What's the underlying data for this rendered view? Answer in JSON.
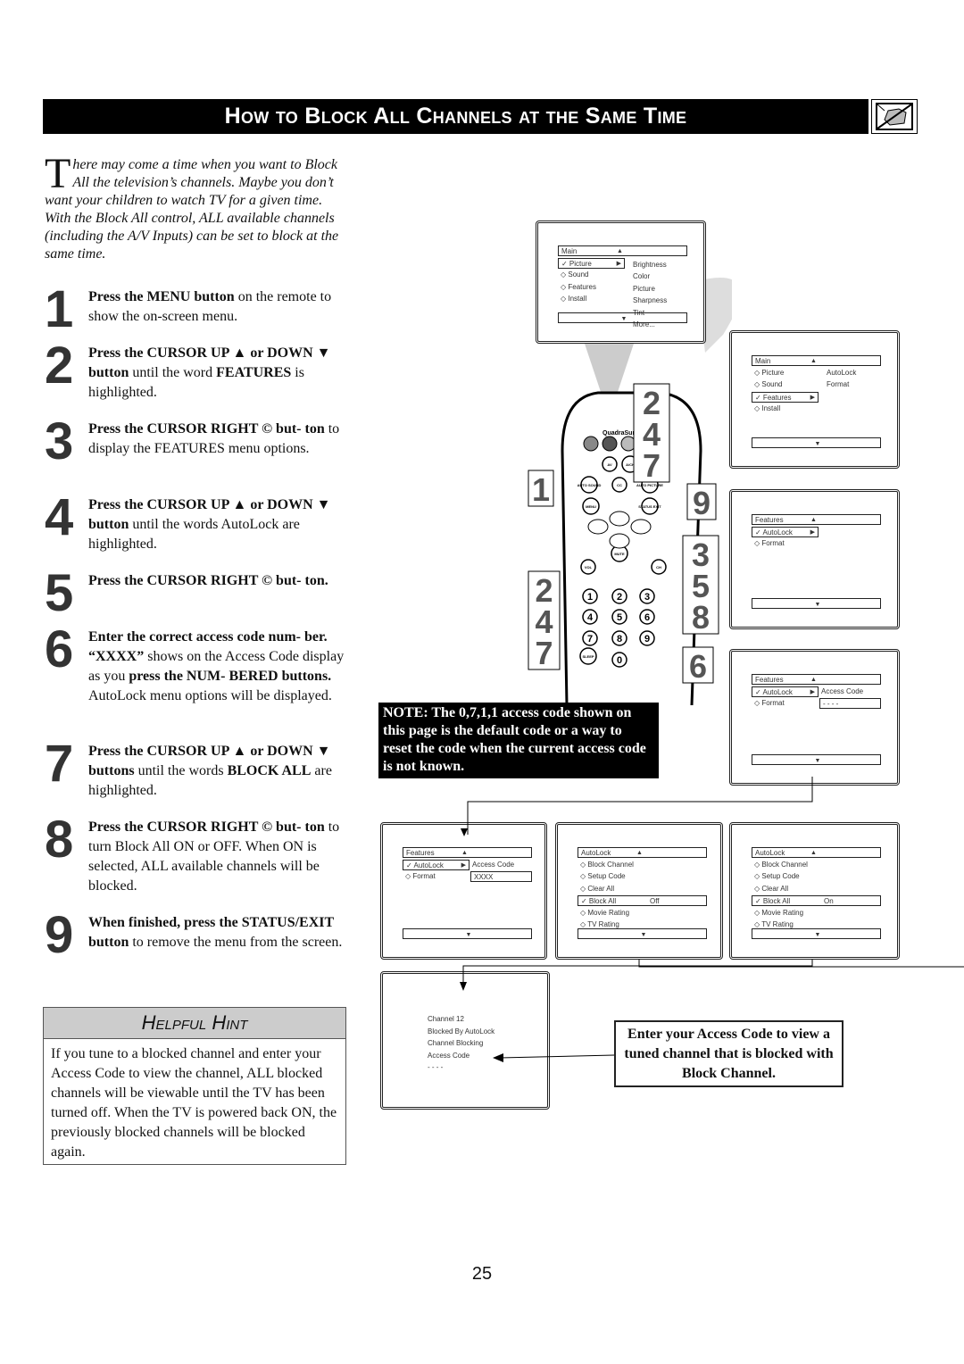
{
  "header": {
    "title": "How to Block All Channels at the Same Time",
    "icon": "no-hand-icon"
  },
  "intro": {
    "dropcap": "T",
    "text": "here may come a time when you want to Block All the television’s channels. Maybe you don’t want your children to watch TV for a given time. With the Block All control, ALL available channels (including the A/V Inputs) can be set to block at the same time."
  },
  "steps": [
    {
      "num": "1",
      "html": "<b>Press the MENU button</b> on the remote to show the on-screen menu."
    },
    {
      "num": "2",
      "html": "<b>Press the CURSOR UP ▲ or DOWN ▼ button</b> until the word <b>FEATURES</b> is highlighted."
    },
    {
      "num": "3",
      "html": "<b>Press the CURSOR RIGHT © but-</b> <b>ton</b> to display the FEATURES menu options."
    },
    {
      "num": "4",
      "html": "<b>Press the CURSOR UP ▲ or DOWN ▼ button</b> until the words AutoLock are highlighted."
    },
    {
      "num": "5",
      "html": "<b>Press the CURSOR RIGHT © but- ton.</b>"
    },
    {
      "num": "6",
      "html": "<b>Enter the correct access code num- ber. “XXXX”</b> shows on the Access Code display as you <b>press the NUM- BERED buttons.</b> AutoLock menu options will be displayed."
    },
    {
      "num": "7",
      "html": "<b>Press the CURSOR UP ▲ or DOWN ▼ buttons</b> until the words <b>BLOCK ALL</b> are highlighted."
    },
    {
      "num": "8",
      "html": "<b>Press the CURSOR RIGHT © but-</b> <b>ton</b> to turn Block All ON or OFF. When ON is selected, ALL available channels will be blocked."
    },
    {
      "num": "9",
      "html": "<b>When finished, press the STATUS/EXIT button</b> to remove the menu from the screen."
    }
  ],
  "hint": {
    "title": "Helpful Hint",
    "text": "If you tune to a blocked channel and enter your Access Code to view the channel, ALL blocked channels will be viewable until the TV has been turned off. When the TV is powered back ON, the previously blocked channels will be blocked again."
  },
  "note": "NOTE: The 0,7,1,1 access code shown on this page is the default code or a way to reset the code when the current access code is not known.",
  "access_callout": "Enter your Access Code to view a tuned channel that is blocked with Block Channel.",
  "page_number": "25",
  "remote": {
    "brand": "QuadraSurf™",
    "buttons": [
      "MENU",
      "AV",
      "A/CH",
      "AUTO SOUND",
      "CC",
      "AUTO PICTURE",
      "STATUS EXIT",
      "MUTE",
      "VOL",
      "CH",
      "SLEEP",
      "1",
      "2",
      "3",
      "4",
      "5",
      "6",
      "7",
      "8",
      "9",
      "0"
    ],
    "callouts": [
      "1",
      "2\n4\n7",
      "9",
      "3\n5\n8",
      "2\n4\n7",
      "6"
    ]
  },
  "screens": [
    {
      "title": "Main",
      "items": [
        {
          "m": "✓",
          "t": "Picture",
          "sel": true,
          "arrow": true
        },
        {
          "m": "◇",
          "t": "Sound"
        },
        {
          "m": "◇",
          "t": "Features"
        },
        {
          "m": "◇",
          "t": "Install"
        }
      ],
      "right": [
        "Brightness",
        "Color",
        "Picture",
        "Sharpness",
        "Tint",
        "More..."
      ]
    },
    {
      "title": "Main",
      "items": [
        {
          "m": "◇",
          "t": "Picture"
        },
        {
          "m": "◇",
          "t": "Sound"
        },
        {
          "m": "✓",
          "t": "Features",
          "sel": true,
          "arrow": true
        },
        {
          "m": "◇",
          "t": "Install"
        }
      ],
      "right": [
        "AutoLock",
        "Format"
      ]
    },
    {
      "title": "Features",
      "items": [
        {
          "m": "✓",
          "t": "AutoLock",
          "sel": true,
          "arrow": true
        },
        {
          "m": "◇",
          "t": "Format"
        }
      ],
      "right": []
    },
    {
      "title": "Features",
      "items": [
        {
          "m": "✓",
          "t": "AutoLock",
          "sel": true,
          "arrow": true
        },
        {
          "m": "◇",
          "t": "Format"
        }
      ],
      "right": [
        "Access Code"
      ],
      "code": "- - - -"
    },
    {
      "title": "Features",
      "items": [
        {
          "m": "✓",
          "t": "AutoLock",
          "sel": true,
          "arrow": true
        },
        {
          "m": "◇",
          "t": "Format"
        }
      ],
      "right": [
        "Access Code"
      ],
      "code": "XXXX"
    },
    {
      "title": "AutoLock",
      "items": [
        {
          "m": "◇",
          "t": "Block Channel"
        },
        {
          "m": "◇",
          "t": "Setup Code"
        },
        {
          "m": "◇",
          "t": "Clear All"
        },
        {
          "m": "✓",
          "t": "Block All",
          "sel": true,
          "val": "Off"
        },
        {
          "m": "◇",
          "t": "Movie Rating"
        },
        {
          "m": "◇",
          "t": "TV Rating"
        }
      ],
      "right": []
    },
    {
      "title": "AutoLock",
      "items": [
        {
          "m": "◇",
          "t": "Block Channel"
        },
        {
          "m": "◇",
          "t": "Setup Code"
        },
        {
          "m": "◇",
          "t": "Clear All"
        },
        {
          "m": "✓",
          "t": "Block All",
          "sel": true,
          "val": "On"
        },
        {
          "m": "◇",
          "t": "Movie Rating"
        },
        {
          "m": "◇",
          "t": "TV Rating"
        }
      ],
      "right": []
    }
  ],
  "blocked_screen": {
    "lines": [
      "Channel 12",
      "Blocked By AutoLock",
      "Channel Blocking",
      "Access Code",
      "- - - -"
    ]
  }
}
